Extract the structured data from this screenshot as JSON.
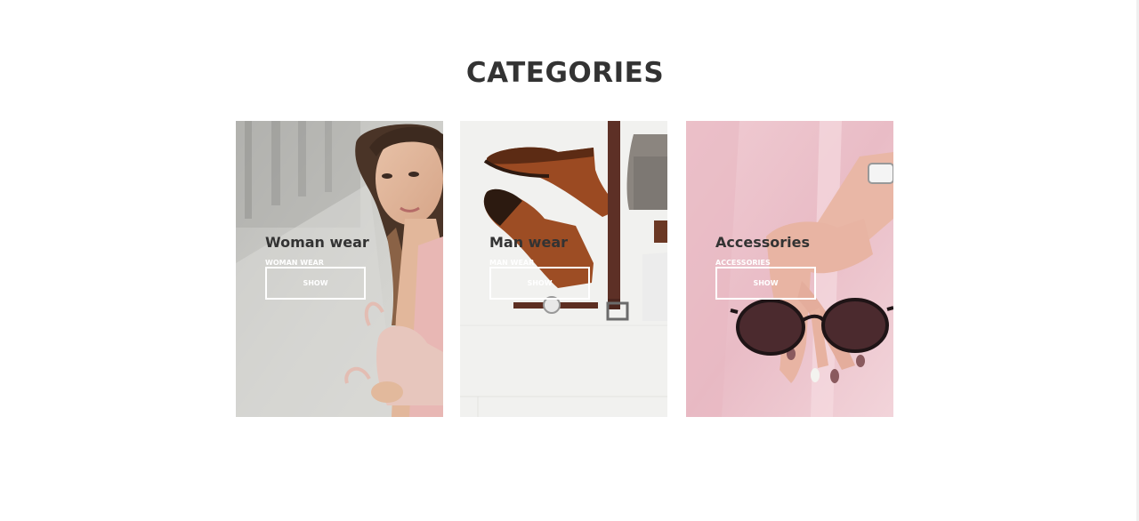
{
  "section": {
    "title": "CATEGORIES"
  },
  "categories": [
    {
      "title": "Woman wear",
      "subtitle": "WOMAN WEAR",
      "button": "SHOW"
    },
    {
      "title": "Man wear",
      "subtitle": "MAN WEAR",
      "button": "SHOW"
    },
    {
      "title": "Accessories",
      "subtitle": "ACCESSORIES",
      "button": "SHOW"
    }
  ],
  "colors": {
    "heading": "#333333",
    "background": "#ffffff",
    "button_border": "#ffffff"
  }
}
